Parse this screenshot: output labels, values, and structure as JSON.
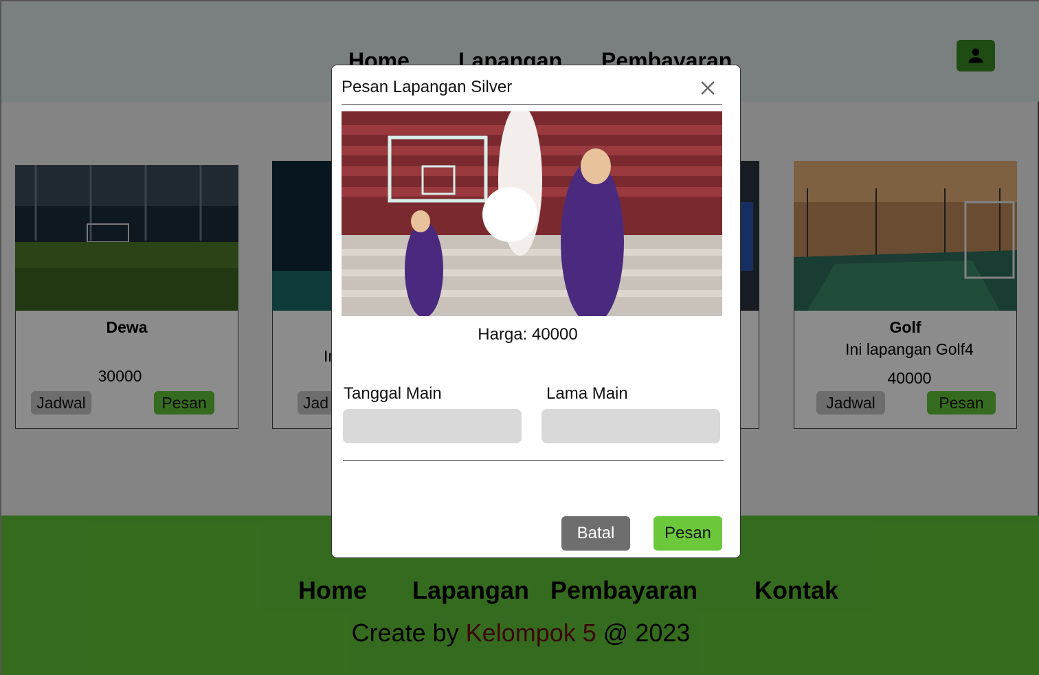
{
  "nav": {
    "home": "Home",
    "lapangan": "Lapangan",
    "pembayaran": "Pembayaran"
  },
  "profile": {
    "icon": "user-icon"
  },
  "cards": [
    {
      "name": "Dewa",
      "desc": "",
      "price": "30000",
      "jadwal": "Jadwal",
      "pesan": "Pesan"
    },
    {
      "name": "",
      "desc": "Ir",
      "price": "",
      "jadwal": "Jad",
      "pesan": ""
    },
    {
      "name": "Golf",
      "desc": "Ini lapangan Golf4",
      "price": "40000",
      "jadwal": "Jadwal",
      "pesan": "Pesan"
    }
  ],
  "footer": {
    "links": [
      "Home",
      "Lapangan",
      "Pembayaran",
      "Kontak"
    ],
    "credit_prefix": "Create by ",
    "credit_group": "Kelompok 5",
    "credit_suffix": " @ 2023"
  },
  "modal": {
    "title": "Pesan Lapangan Silver",
    "price": "Harga: 40000",
    "tanggal_label": "Tanggal Main",
    "lama_label": "Lama Main",
    "tanggal_value": "",
    "lama_value": "",
    "cancel": "Batal",
    "submit": "Pesan"
  },
  "colors": {
    "accent_green": "#61c437",
    "dark_green_button": "#3a8a25",
    "cancel_grey": "#6e6e6e",
    "credit_red": "#6a0c0c"
  }
}
